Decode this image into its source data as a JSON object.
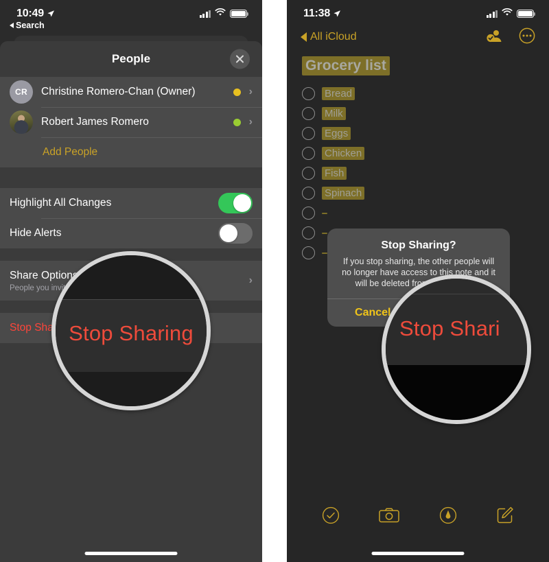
{
  "left_phone": {
    "status_bar": {
      "time": "10:49",
      "location_icon": "location-arrow-icon",
      "cellular_icon": "cellular-bars-icon",
      "wifi_icon": "wifi-icon",
      "battery_icon": "battery-full-icon"
    },
    "back_crumb": {
      "label": "Search",
      "icon": "back-triangle-icon"
    },
    "sheet": {
      "title": "People",
      "close_icon": "close-x-icon",
      "people": [
        {
          "initials": "CR",
          "name": "Christine Romero-Chan (Owner)",
          "dot_color": "#e8c020",
          "avatar_type": "initials",
          "chevron": "›"
        },
        {
          "initials": "",
          "name": "Robert James Romero",
          "dot_color": "#9acd32",
          "avatar_type": "photo",
          "chevron": "›"
        }
      ],
      "add_people_label": "Add People",
      "toggles": [
        {
          "label": "Highlight All Changes",
          "state": "on"
        },
        {
          "label": "Hide Alerts",
          "state": "off"
        }
      ],
      "share_options": {
        "title": "Share Options",
        "subtitle": "People you invite can make changes",
        "chevron": "›"
      },
      "stop_sharing_label": "Stop Sharing"
    },
    "magnifier": {
      "text": "Stop Sharing"
    },
    "home_indicator": "home-indicator"
  },
  "right_phone": {
    "status_bar": {
      "time": "11:38",
      "location_icon": "location-arrow-icon",
      "cellular_icon": "cellular-bars-icon",
      "wifi_icon": "wifi-icon",
      "battery_icon": "battery-full-icon"
    },
    "nav": {
      "back_label": "All iCloud",
      "back_icon": "chevron-left-icon",
      "shared_people_icon": "person-checkmark-icon",
      "more_icon": "ellipsis-circle-icon"
    },
    "note": {
      "title": "Grocery list",
      "items": [
        "Bread",
        "Milk",
        "Eggs",
        "Chicken",
        "Fish",
        "Spinach",
        "",
        "",
        ""
      ]
    },
    "alert": {
      "title": "Stop Sharing?",
      "message": "If you stop sharing, the other people will no longer have access to this note and it will be deleted from their devices.",
      "cancel_label": "Cancel",
      "confirm_label": "Stop Sharing"
    },
    "magnifier": {
      "text": "Stop Shari"
    },
    "toolbar": [
      {
        "icon": "checklist-circle-icon",
        "label": "Checklist"
      },
      {
        "icon": "camera-icon",
        "label": "Camera"
      },
      {
        "icon": "markup-pen-circle-icon",
        "label": "Markup"
      },
      {
        "icon": "compose-icon",
        "label": "Compose"
      }
    ],
    "home_indicator": "home-indicator"
  },
  "colors": {
    "accent_gold": "#c9a227",
    "destructive_red": "#ff453a",
    "toggle_on_green": "#34c759",
    "highlight_olive": "#7d6f28"
  }
}
